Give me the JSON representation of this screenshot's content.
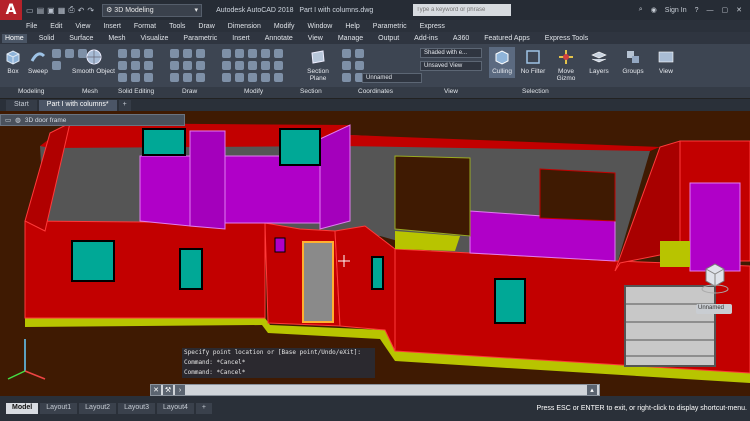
{
  "titlebar": {
    "workspace": "3D Modeling",
    "app_title": "Autodesk AutoCAD 2018",
    "file_title": "Part I with columns.dwg",
    "search_placeholder": "Type a keyword or phrase",
    "sign_in": "Sign In"
  },
  "menu": [
    "File",
    "Edit",
    "View",
    "Insert",
    "Format",
    "Tools",
    "Draw",
    "Dimension",
    "Modify",
    "Window",
    "Help",
    "Parametric",
    "Express"
  ],
  "ribbon_tabs": [
    "Home",
    "Solid",
    "Surface",
    "Mesh",
    "Visualize",
    "Parametric",
    "Insert",
    "Annotate",
    "View",
    "Manage",
    "Output",
    "Add-ins",
    "A360",
    "Featured Apps",
    "Express Tools"
  ],
  "ribbon": {
    "box": "Box",
    "sweep": "Sweep",
    "smooth_object": "Smooth Object",
    "section_plane": "Section Plane",
    "visual_style": "Shaded with e...",
    "unsaved_view": "Unsaved View",
    "unnamed": "Unnamed",
    "culling": "Culling",
    "no_filter": "No Filter",
    "move_gizmo": "Move Gizmo",
    "layers": "Layers",
    "groups": "Groups",
    "view": "View"
  },
  "panels": {
    "modeling": "Modeling",
    "mesh": "Mesh",
    "solid_editing": "Solid Editing",
    "draw": "Draw",
    "modify": "Modify",
    "section": "Section",
    "coordinates": "Coordinates",
    "view": "View",
    "selection": "Selection"
  },
  "doc_tabs": {
    "start": "Start",
    "active": "Part I with columns*"
  },
  "viewport": {
    "style_label": "3D door frame",
    "viewcube_label": "Unnamed"
  },
  "command": {
    "prompt": "Specify point location or [Base point/Undo/eXit]:",
    "history1": "Command: *Cancel*",
    "history2": "Command: *Cancel*",
    "input_placeholder": ""
  },
  "layouts": [
    "Model",
    "Layout1",
    "Layout2",
    "Layout3",
    "Layout4"
  ],
  "status_hint": "Press ESC or ENTER to exit, or right-click to display shortcut-menu.",
  "colors": {
    "wall_red": "#c20000",
    "interior_magenta": "#b000c8",
    "window_teal": "#00a896",
    "floor_yellow": "#b8c400",
    "background": "#3f1a02"
  }
}
